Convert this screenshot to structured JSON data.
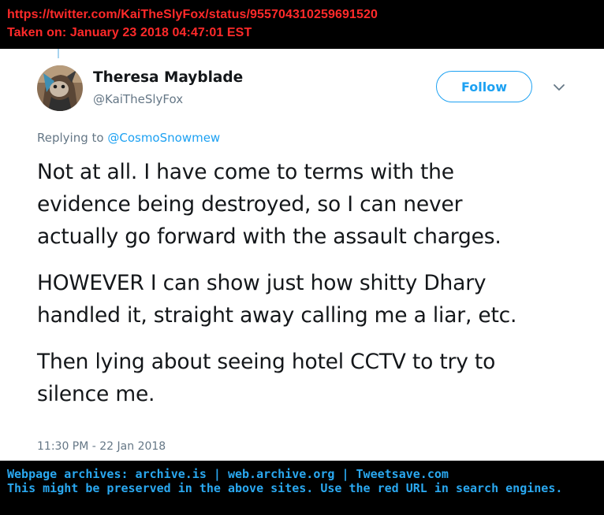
{
  "header": {
    "url": "https://twitter.com/KaiTheSlyFox/status/955704310259691520",
    "taken_on": "Taken on:  January 23 2018  04:47:01  EST"
  },
  "tweet": {
    "display_name": "Theresa Mayblade",
    "handle": "@KaiTheSlyFox",
    "follow_label": "Follow",
    "replying_prefix": "Replying to",
    "replying_to": "@CosmoSnowmew",
    "text_lines": [
      "Not at all. I have come to terms with the",
      "evidence being destroyed, so I can never",
      "actually go forward with the assault charges.",
      "HOWEVER I can show just how shitty Dhary",
      "handled it, straight away calling me a liar, etc.",
      "Then lying about seeing hotel CCTV to try to",
      "silence me."
    ],
    "timestamp": "11:30 PM - 22 Jan 2018"
  },
  "footer": {
    "archives": "Webpage archives:  archive.is | web.archive.org | Tweetsave.com",
    "note": "This might be preserved in the above sites. Use the red URL in search engines."
  },
  "colors": {
    "accent": "#1da1f2",
    "header_text": "#ff2a2a",
    "footer_text": "#2aa8f0",
    "bar_background": "#000000"
  },
  "icons": [
    "avatar-image",
    "chevron-down-icon"
  ]
}
